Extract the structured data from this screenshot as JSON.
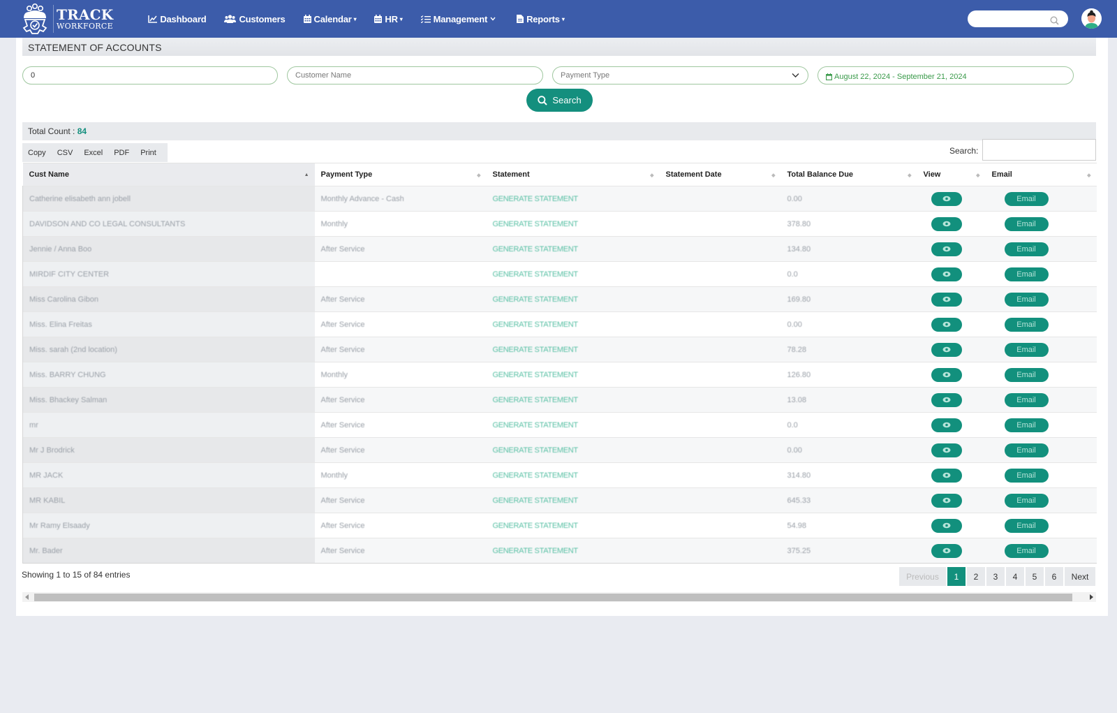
{
  "nav": {
    "brand_top": "TRACK",
    "brand_bottom": "WORKFORCE",
    "items": [
      {
        "label": "Dashboard",
        "icon": "chart-line-icon",
        "dropdown": false
      },
      {
        "label": "Customers",
        "icon": "users-icon",
        "dropdown": false
      },
      {
        "label": "Calendar",
        "icon": "calendar-icon",
        "dropdown": true
      },
      {
        "label": "HR",
        "icon": "calendar-icon",
        "dropdown": true
      },
      {
        "label": "Management",
        "icon": "list-check-icon",
        "dropdown": true
      },
      {
        "label": "Reports",
        "icon": "file-icon",
        "dropdown": true
      }
    ],
    "search_placeholder": ""
  },
  "page": {
    "title": "STATEMENT OF ACCOUNTS"
  },
  "filters": {
    "id_value": "0",
    "customer_name_placeholder": "Customer Name",
    "payment_type_placeholder": "Payment Type",
    "date_range": "August 22, 2024 - September 21, 2024",
    "search_button": "Search"
  },
  "summary": {
    "total_count_label": "Total Count : ",
    "total_count_value": "84"
  },
  "export_buttons": [
    "Copy",
    "CSV",
    "Excel",
    "PDF",
    "Print"
  ],
  "table_search_label": "Search:",
  "table": {
    "columns": [
      "Cust Name",
      "Payment Type",
      "Statement",
      "Statement Date",
      "Total Balance Due",
      "View",
      "Email"
    ],
    "rows": [
      {
        "name": "Catherine elisabeth ann jobell",
        "payment_type": "Monthly Advance - Cash",
        "statement": "GENERATE STATEMENT",
        "date": "",
        "balance": "0.00",
        "email": "Email"
      },
      {
        "name": "DAVIDSON AND CO LEGAL CONSULTANTS",
        "payment_type": "Monthly",
        "statement": "GENERATE STATEMENT",
        "date": "",
        "balance": "378.80",
        "email": "Email"
      },
      {
        "name": "Jennie / Anna Boo",
        "payment_type": "After Service",
        "statement": "GENERATE STATEMENT",
        "date": "",
        "balance": "134.80",
        "email": "Email"
      },
      {
        "name": "MIRDIF CITY CENTER",
        "payment_type": "",
        "statement": "GENERATE STATEMENT",
        "date": "",
        "balance": "0.0",
        "email": "Email"
      },
      {
        "name": "Miss Carolina Gibon",
        "payment_type": "After Service",
        "statement": "GENERATE STATEMENT",
        "date": "",
        "balance": "169.80",
        "email": "Email"
      },
      {
        "name": "Miss. Elina Freitas",
        "payment_type": "After Service",
        "statement": "GENERATE STATEMENT",
        "date": "",
        "balance": "0.00",
        "email": "Email"
      },
      {
        "name": "Miss. sarah (2nd location)",
        "payment_type": "After Service",
        "statement": "GENERATE STATEMENT",
        "date": "",
        "balance": "78.28",
        "email": "Email"
      },
      {
        "name": "Miss. BARRY CHUNG",
        "payment_type": "Monthly",
        "statement": "GENERATE STATEMENT",
        "date": "",
        "balance": "126.80",
        "email": "Email"
      },
      {
        "name": "Miss. Bhackey Salman",
        "payment_type": "After Service",
        "statement": "GENERATE STATEMENT",
        "date": "",
        "balance": "13.08",
        "email": "Email"
      },
      {
        "name": "mr",
        "payment_type": "After Service",
        "statement": "GENERATE STATEMENT",
        "date": "",
        "balance": "0.0",
        "email": "Email"
      },
      {
        "name": "Mr J Brodrick",
        "payment_type": "After Service",
        "statement": "GENERATE STATEMENT",
        "date": "",
        "balance": "0.00",
        "email": "Email"
      },
      {
        "name": "MR JACK",
        "payment_type": "Monthly",
        "statement": "GENERATE STATEMENT",
        "date": "",
        "balance": "314.80",
        "email": "Email"
      },
      {
        "name": "MR KABIL",
        "payment_type": "After Service",
        "statement": "GENERATE STATEMENT",
        "date": "",
        "balance": "645.33",
        "email": "Email"
      },
      {
        "name": "Mr Ramy Elsaady",
        "payment_type": "After Service",
        "statement": "GENERATE STATEMENT",
        "date": "",
        "balance": "54.98",
        "email": "Email"
      },
      {
        "name": "Mr. Bader",
        "payment_type": "After Service",
        "statement": "GENERATE STATEMENT",
        "date": "",
        "balance": "375.25",
        "email": "Email"
      }
    ]
  },
  "footer": {
    "info": "Showing 1 to 15 of 84 entries",
    "previous": "Previous",
    "pages": [
      "1",
      "2",
      "3",
      "4",
      "5",
      "6"
    ],
    "current_page": "1",
    "next": "Next"
  },
  "colors": {
    "navbar": "#3c5caa",
    "accent": "#12907d",
    "date_text": "#3a9a4a"
  }
}
